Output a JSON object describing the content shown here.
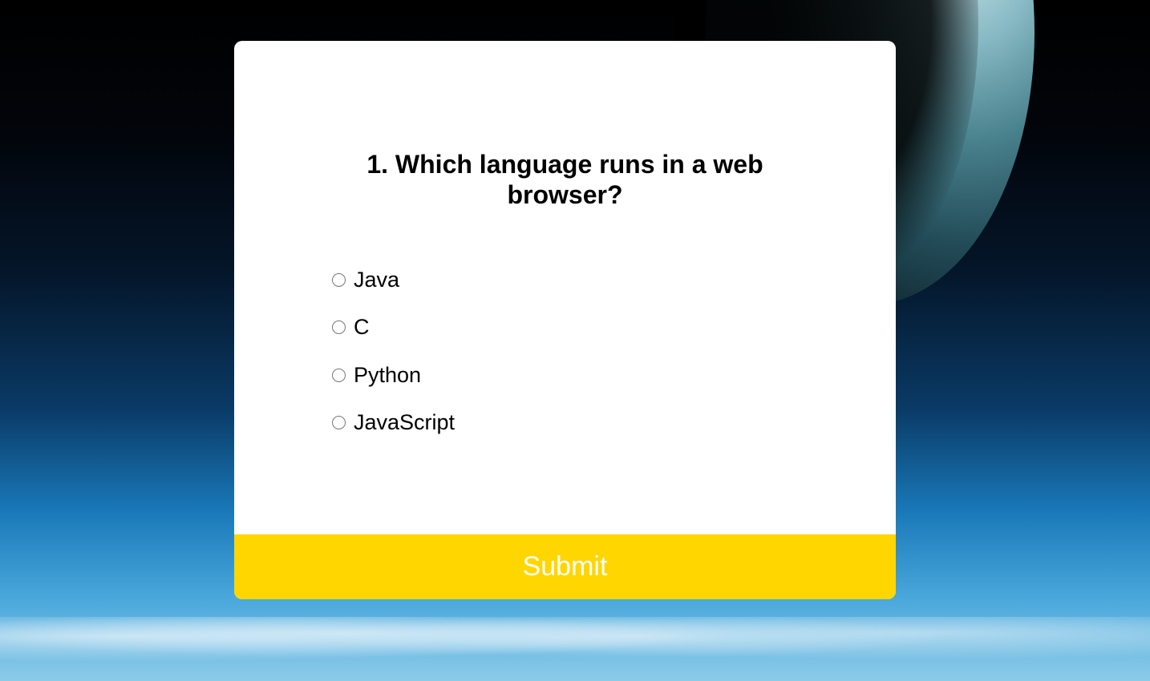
{
  "quiz": {
    "question": "1. Which language runs in a web browser?",
    "answers": [
      {
        "label": "Java"
      },
      {
        "label": "C"
      },
      {
        "label": "Python"
      },
      {
        "label": "JavaScript"
      }
    ],
    "submit_label": "Submit"
  },
  "colors": {
    "submit_background": "#ffd600",
    "submit_text": "#ffffff",
    "card_background": "#ffffff"
  }
}
